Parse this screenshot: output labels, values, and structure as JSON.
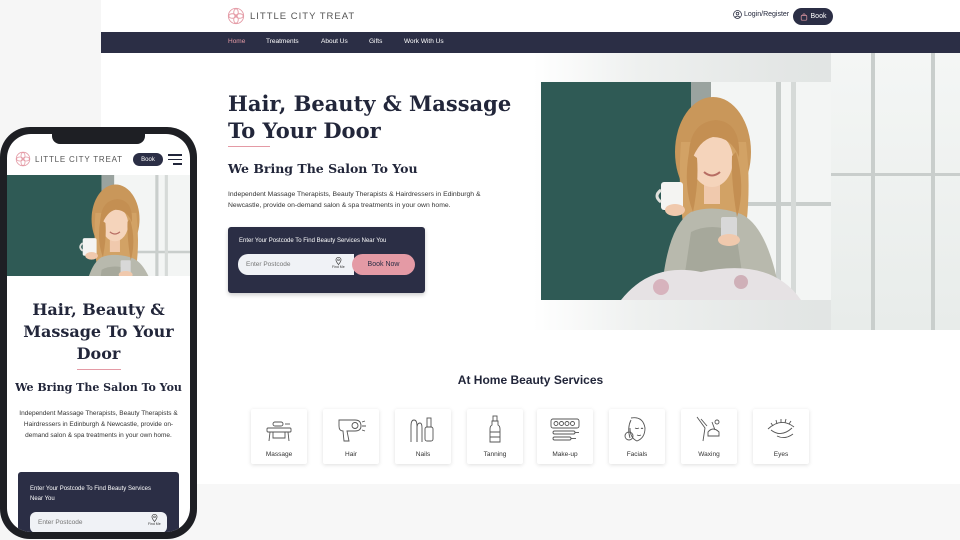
{
  "brand": {
    "name": "LITTLE CITY TREAT",
    "accent": "#e49aa5",
    "navy": "#2b2e45"
  },
  "header": {
    "login_label": "Login/Register",
    "book_label": "Book"
  },
  "nav": {
    "items": [
      "Home",
      "Treatments",
      "About Us",
      "Gifts",
      "Work With Us"
    ],
    "active": "Home"
  },
  "hero": {
    "title": "Hair, Beauty & Massage To Your Door",
    "subtitle": "We Bring The Salon To You",
    "description": "Independent Massage Therapists, Beauty Therapists & Hairdressers in Edinburgh & Newcastle, provide on-demand salon & spa treatments in your own home.",
    "search": {
      "label": "Enter Your Postcode To Find Beauty Services Near You",
      "placeholder": "Enter Postcode",
      "find_me": "Find Me",
      "button": "Book Now"
    }
  },
  "services": {
    "title": "At Home Beauty Services",
    "items": [
      {
        "label": "Massage",
        "icon": "massage-table-icon"
      },
      {
        "label": "Hair",
        "icon": "hair-dryer-icon"
      },
      {
        "label": "Nails",
        "icon": "nail-polish-icon"
      },
      {
        "label": "Tanning",
        "icon": "tanning-bottle-icon"
      },
      {
        "label": "Make-up",
        "icon": "makeup-palette-icon"
      },
      {
        "label": "Facials",
        "icon": "face-icon"
      },
      {
        "label": "Waxing",
        "icon": "waxing-icon"
      },
      {
        "label": "Eyes",
        "icon": "eye-lashes-icon"
      }
    ]
  },
  "mobile": {
    "book_label": "Book"
  }
}
